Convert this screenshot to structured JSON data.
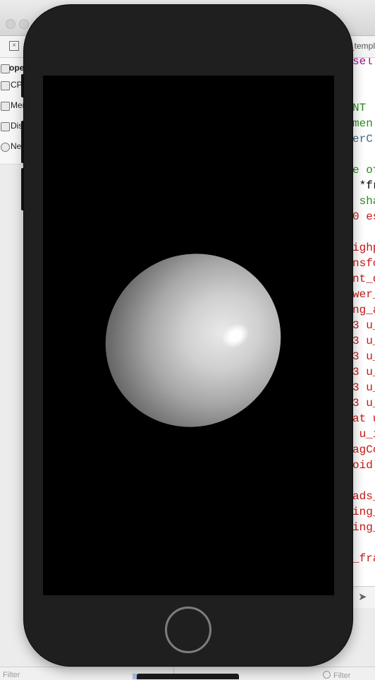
{
  "window": {
    "tab_label": "_templa"
  },
  "navigator": {
    "project_name": "open",
    "items": [
      {
        "label": "CP",
        "icon": "cpu-gauge-icon"
      },
      {
        "label": "Mer",
        "icon": "memory-gauge-icon"
      },
      {
        "label": "Dis",
        "icon": "disk-gauge-icon"
      },
      {
        "label": "Ne",
        "icon": "network-gauge-icon"
      }
    ]
  },
  "editor": {
    "lines": [
      {
        "text": "sel",
        "color": "#a80b93"
      },
      {
        "text": "",
        "color": "#000000"
      },
      {
        "text": "",
        "color": "#000000"
      },
      {
        "text": "NT",
        "color": "#2a8a1e"
      },
      {
        "text": "men",
        "color": "#2a8a1e"
      },
      {
        "text": "erC",
        "color": "#3c6e8a"
      },
      {
        "text": "",
        "color": "#000000"
      },
      {
        "text": "e of",
        "color": "#2a8a1e"
      },
      {
        "text": " *fr",
        "color": "#000000"
      },
      {
        "text": " sha",
        "color": "#2a8a1e"
      },
      {
        "text": "0 es",
        "color": "#c41a16"
      },
      {
        "text": "",
        "color": "#000000"
      },
      {
        "text": "ighp",
        "color": "#c41a16"
      },
      {
        "text": "nsfo",
        "color": "#c41a16"
      },
      {
        "text": "nt_d",
        "color": "#c41a16"
      },
      {
        "text": "wer_",
        "color": "#c41a16"
      },
      {
        "text": "ng_a",
        "color": "#c41a16"
      },
      {
        "text": "3 u_",
        "color": "#c41a16"
      },
      {
        "text": "3 u_",
        "color": "#c41a16"
      },
      {
        "text": "3 u_",
        "color": "#c41a16"
      },
      {
        "text": "3 u_",
        "color": "#c41a16"
      },
      {
        "text": "3 u_",
        "color": "#c41a16"
      },
      {
        "text": "3 u_",
        "color": "#c41a16"
      },
      {
        "text": "at u",
        "color": "#c41a16"
      },
      {
        "text": " u_i",
        "color": "#c41a16"
      },
      {
        "text": "agCo",
        "color": "#c41a16"
      },
      {
        "text": "oid)",
        "color": "#c41a16"
      },
      {
        "text": "",
        "color": "#000000"
      },
      {
        "text": "ads_",
        "color": "#c41a16"
      },
      {
        "text": "ing_",
        "color": "#c41a16"
      },
      {
        "text": "ing_e",
        "color": "#c41a16"
      },
      {
        "text": "",
        "color": "#000000"
      },
      {
        "text": "_fra",
        "color": "#c41a16"
      }
    ]
  },
  "bottom": {
    "filter_left": "Filter",
    "filter_right": "Filter"
  },
  "simulator": {
    "device": "iPhone",
    "scene": "shaded sphere with specular highlight",
    "background_color": "#000000",
    "bezel_color": "#1f1f1f"
  }
}
